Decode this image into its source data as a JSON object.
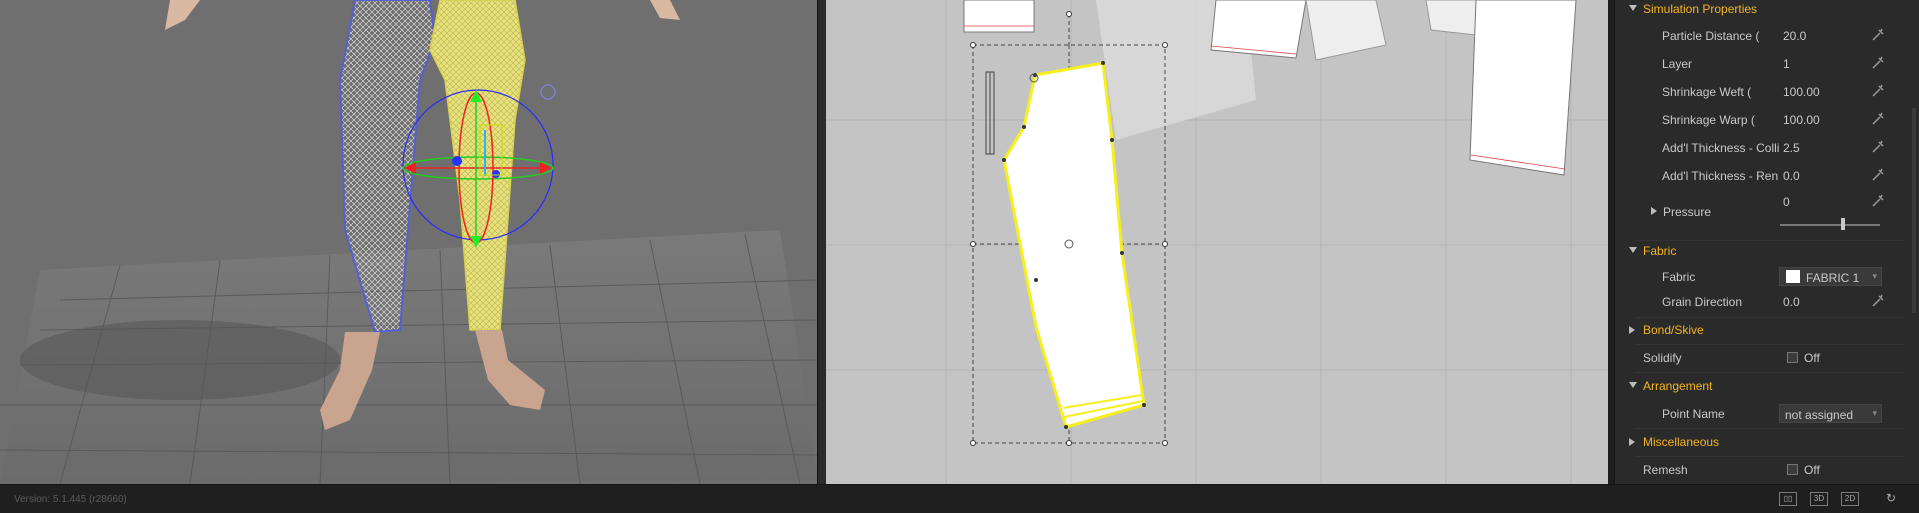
{
  "status_bar": {
    "version": "Version: 5.1.445 (r28660)",
    "view_buttons": [
      "3D",
      "2D"
    ]
  },
  "properties": {
    "simulation": {
      "title": "Simulation Properties",
      "rows": [
        {
          "label": "Particle Distance (",
          "value": "20.0"
        },
        {
          "label": "Layer",
          "value": "1"
        },
        {
          "label": "Shrinkage Weft (",
          "value": "100.00"
        },
        {
          "label": "Shrinkage Warp (",
          "value": "100.00"
        },
        {
          "label": "Add'l Thickness - Colli",
          "value": "2.5"
        },
        {
          "label": "Add'l Thickness - Ren",
          "value": "0.0"
        }
      ],
      "pressure": {
        "label": "Pressure",
        "value": "0",
        "slider_fraction": 0.62
      }
    },
    "fabric": {
      "title": "Fabric",
      "fabric_label": "Fabric",
      "fabric_value": "FABRIC 1",
      "grain_label": "Grain Direction",
      "grain_value": "0.0"
    },
    "bond_skive": {
      "title": "Bond/Skive"
    },
    "solidify": {
      "label": "Solidify",
      "value": "Off"
    },
    "arrangement": {
      "title": "Arrangement",
      "point_label": "Point Name",
      "point_value": "not assigned"
    },
    "miscellaneous": {
      "title": "Miscellaneous"
    },
    "remesh": {
      "label": "Remesh",
      "value": "Off"
    }
  },
  "colors": {
    "section_accent": "#f3b421",
    "selection_yellow": "#f5ef1d",
    "panel_bg": "#2a2a2a"
  },
  "icons": [
    "wrench-icon",
    "expand-triangle-icon",
    "collapse-triangle-icon",
    "gizmo-icon",
    "dropdown-arrow-icon"
  ]
}
